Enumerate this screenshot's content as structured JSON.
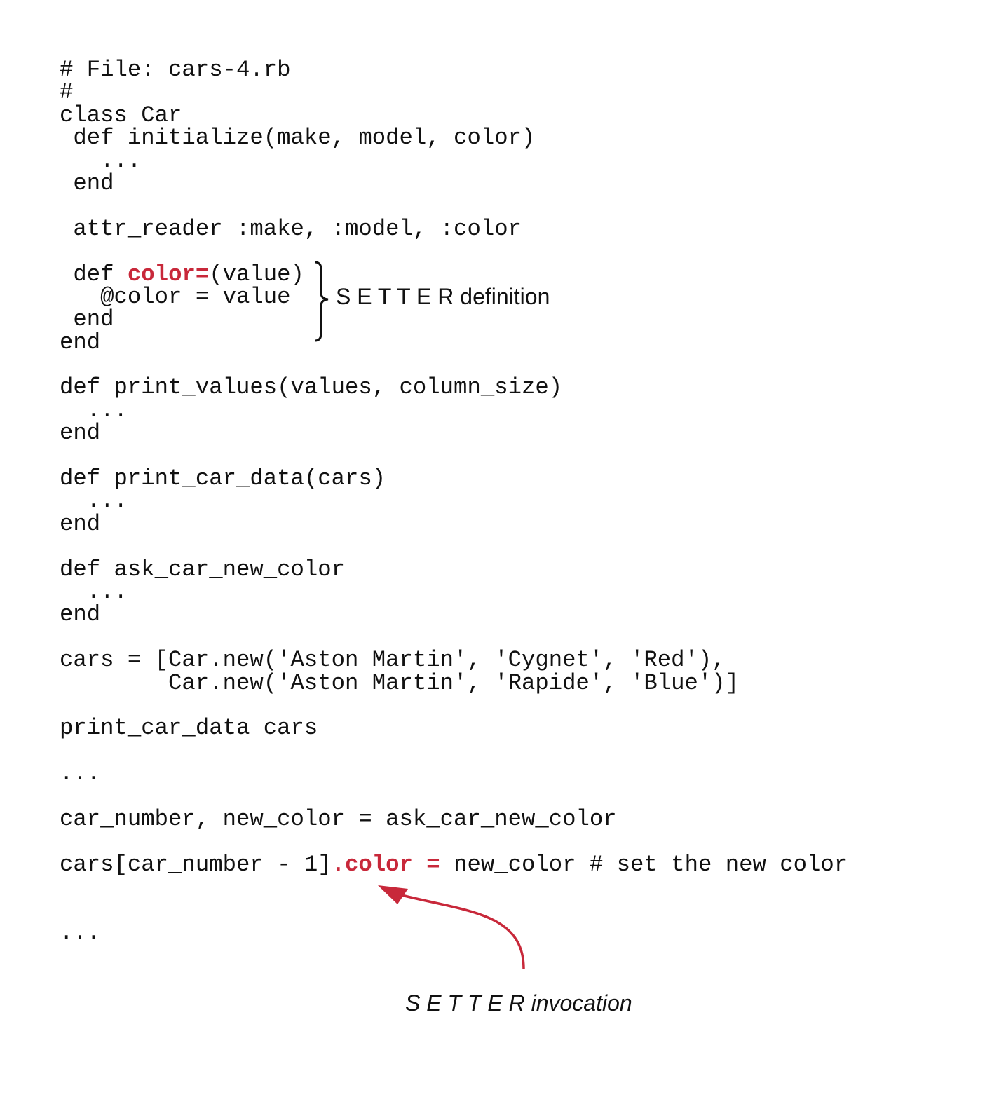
{
  "code_lines": [
    [
      {
        "t": "# File: cars-4.rb"
      }
    ],
    [
      {
        "t": "#"
      }
    ],
    [
      {
        "t": "class Car"
      }
    ],
    [
      {
        "t": " def initialize(make, model, color)"
      }
    ],
    [
      {
        "t": "   ..."
      }
    ],
    [
      {
        "t": " end"
      }
    ],
    [],
    [
      {
        "t": " attr_reader :make, :model, :color"
      }
    ],
    [],
    [
      {
        "t": " def "
      },
      {
        "t": "color=",
        "hl": true
      },
      {
        "t": "(value)"
      }
    ],
    [
      {
        "t": "   @color = value"
      }
    ],
    [
      {
        "t": " end"
      }
    ],
    [
      {
        "t": "end"
      }
    ],
    [],
    [
      {
        "t": "def print_values(values, column_size)"
      }
    ],
    [
      {
        "t": "  ..."
      }
    ],
    [
      {
        "t": "end"
      }
    ],
    [],
    [
      {
        "t": "def print_car_data(cars)"
      }
    ],
    [
      {
        "t": "  ..."
      }
    ],
    [
      {
        "t": "end"
      }
    ],
    [],
    [
      {
        "t": "def ask_car_new_color"
      }
    ],
    [
      {
        "t": "  ..."
      }
    ],
    [
      {
        "t": "end"
      }
    ],
    [],
    [
      {
        "t": "cars = [Car.new('Aston Martin', 'Cygnet', 'Red'),"
      }
    ],
    [
      {
        "t": "        Car.new('Aston Martin', 'Rapide', 'Blue')]"
      }
    ],
    [],
    [
      {
        "t": "print_car_data cars"
      }
    ],
    [],
    [
      {
        "t": "..."
      }
    ],
    [],
    [
      {
        "t": "car_number, new_color = ask_car_new_color"
      }
    ],
    [],
    [
      {
        "t": "cars[car_number - 1]"
      },
      {
        "t": ".color =",
        "hl": true
      },
      {
        "t": " new_color # set the new color"
      }
    ],
    [],
    [],
    [
      {
        "t": "..."
      }
    ]
  ],
  "annotations": {
    "setter_definition": "S E T T E R definition",
    "setter_invocation": "S E T T E R invocation"
  },
  "colors": {
    "highlight": "#c8283a",
    "text": "#111111"
  }
}
